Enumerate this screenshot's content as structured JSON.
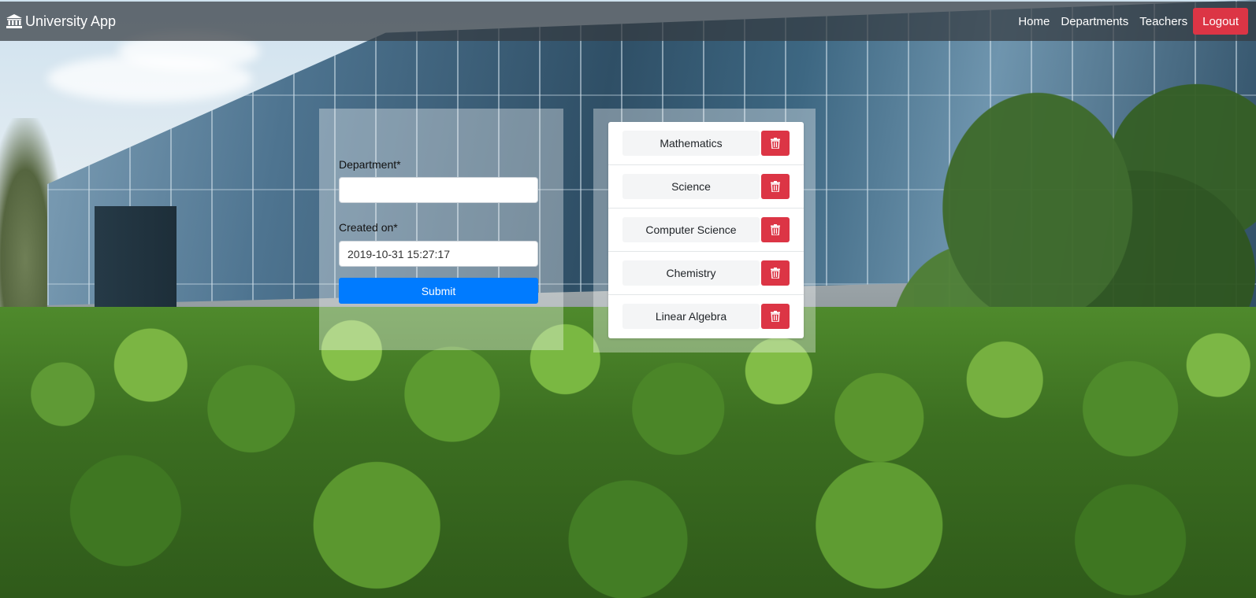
{
  "navbar": {
    "brand": "University App",
    "brand_icon": "institution-icon",
    "links": {
      "home": "Home",
      "departments": "Departments",
      "teachers": "Teachers"
    },
    "logout_label": "Logout"
  },
  "form": {
    "department_label": "Department*",
    "department_value": "",
    "created_label": "Created on*",
    "created_value": "2019-10-31 15:27:17",
    "submit_label": "Submit"
  },
  "departments": [
    {
      "name": "Mathematics",
      "delete_icon": "trash-icon"
    },
    {
      "name": "Science",
      "delete_icon": "trash-icon"
    },
    {
      "name": "Computer Science",
      "delete_icon": "trash-icon"
    },
    {
      "name": "Chemistry",
      "delete_icon": "trash-icon"
    },
    {
      "name": "Linear Algebra",
      "delete_icon": "trash-icon"
    }
  ],
  "colors": {
    "primary": "#007bff",
    "danger": "#dc3545",
    "navbar": "#343a40"
  }
}
